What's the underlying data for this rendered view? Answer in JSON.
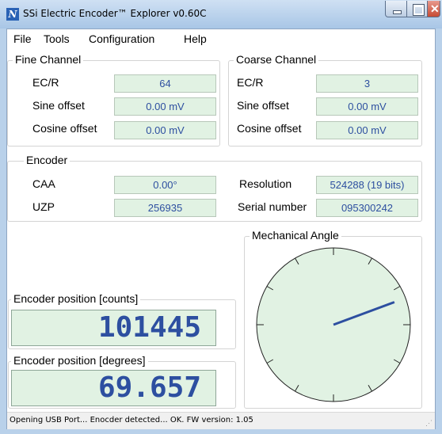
{
  "window": {
    "title": "SSi Electric Encoder™ Explorer v0.60C"
  },
  "menu": [
    "File",
    "Tools",
    "Configuration",
    "Help"
  ],
  "fine_channel": {
    "title": "Fine Channel",
    "ecr_label": "EC/R",
    "ecr": "64",
    "sine_label": "Sine offset",
    "sine": "0.00 mV",
    "cosine_label": "Cosine offset",
    "cosine": "0.00 mV"
  },
  "coarse_channel": {
    "title": "Coarse Channel",
    "ecr_label": "EC/R",
    "ecr": "3",
    "sine_label": "Sine offset",
    "sine": "0.00 mV",
    "cosine_label": "Cosine offset",
    "cosine": "0.00 mV"
  },
  "encoder": {
    "title": "Encoder",
    "caa_label": "CAA",
    "caa": "0.00°",
    "uzp_label": "UZP",
    "uzp": "256935",
    "resolution_label": "Resolution",
    "resolution": "524288 (19 bits)",
    "serial_label": "Serial number",
    "serial": "095300242"
  },
  "position_counts": {
    "title": "Encoder position [counts]",
    "value": "101445"
  },
  "position_degrees": {
    "title": "Encoder position [degrees]",
    "value": "69.657"
  },
  "dial": {
    "title": "Mechanical Angle",
    "angle_deg": 69.657,
    "ticks": 12,
    "face_color": "#e1f2e3",
    "needle_color": "#2d4fa0"
  },
  "status": "Opening USB Port... Enocder detected... OK. FW version: 1.05"
}
